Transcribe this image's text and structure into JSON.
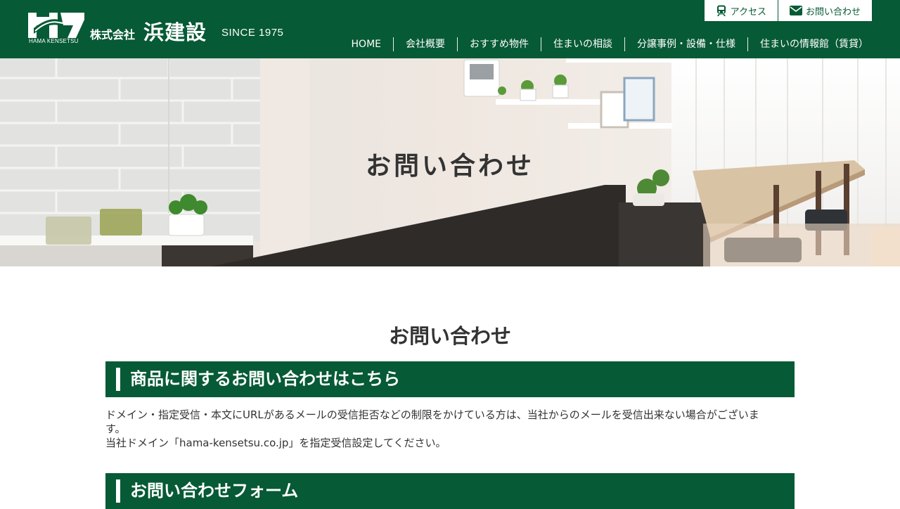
{
  "header": {
    "logo": {
      "prefix": "株式会社",
      "name": "浜建設",
      "since": "SINCE 1975",
      "sub": "HAMA KENSETSU"
    },
    "utility_links": [
      {
        "label": "アクセス",
        "icon": "train-icon"
      },
      {
        "label": "お問い合わせ",
        "icon": "envelope-icon"
      }
    ],
    "nav": [
      {
        "label": "HOME"
      },
      {
        "label": "会社概要"
      },
      {
        "label": "おすすめ物件"
      },
      {
        "label": "住まいの相談"
      },
      {
        "label": "分譲事例・設備・仕様"
      },
      {
        "label": "住まいの情報館（賃貸）"
      }
    ]
  },
  "hero": {
    "title": "お問い合わせ"
  },
  "main": {
    "page_title": "お問い合わせ",
    "section1": {
      "heading": "商品に関するお問い合わせはこちら",
      "notice_lines": [
        "ドメイン・指定受信・本文にURLがあるメールの受信拒否などの制限をかけている方は、当社からのメールを受信出来ない場合がございま",
        "す。",
        "当社ドメイン「hama-kensetsu.co.jp」を指定受信設定してください。"
      ]
    },
    "section2": {
      "heading": "お問い合わせフォーム"
    }
  },
  "colors": {
    "brand_green": "#065a35",
    "text": "#333333",
    "background": "#ffffff"
  }
}
